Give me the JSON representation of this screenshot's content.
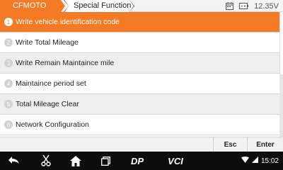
{
  "breadcrumb": {
    "root": "CFMOTO",
    "current": "Special Function"
  },
  "status": {
    "voltage": "12.35V",
    "time": "15:02"
  },
  "menu": {
    "items": [
      {
        "num": "1",
        "label": "Write vehicle identification code",
        "selected": true
      },
      {
        "num": "2",
        "label": "Write Total Mileage",
        "selected": false
      },
      {
        "num": "3",
        "label": "Write Remain Maintaince mile",
        "selected": false
      },
      {
        "num": "4",
        "label": "Maintaince period set",
        "selected": false
      },
      {
        "num": "5",
        "label": "Total Mileage Clear",
        "selected": false
      },
      {
        "num": "6",
        "label": "Network Configuration",
        "selected": false
      }
    ]
  },
  "actions": {
    "esc_label": "Esc",
    "enter_label": "Enter"
  },
  "navbar": {
    "dp_label": "DP",
    "vci_label": "VCI"
  },
  "colors": {
    "accent": "#f47a26",
    "navbar_bg": "#0d0d0d"
  },
  "icons": [
    "back-icon",
    "scissors-icon",
    "home-icon",
    "recents-icon",
    "dp-icon",
    "vci-icon",
    "calendar-icon",
    "battery-icon",
    "wifi-icon",
    "signal-icon"
  ]
}
